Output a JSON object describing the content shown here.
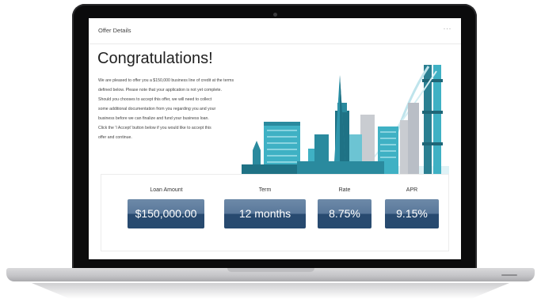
{
  "header": {
    "title": "Offer Details",
    "more": "···"
  },
  "heading": "Congratulations!",
  "message_lines": [
    "We are pleased to offer you a $150,000 business line of credit at the terms",
    "defined below.  Please note that your application is not yet complete.",
    "Should you chooses to accept this offer, we will need to collect",
    "some additional documentation from you regarding you and your",
    "business before we can finalize and fund your business loan.",
    "Click the 'I Accept' button below if you would like to accept this",
    "offer and continue."
  ],
  "metrics": {
    "loan_amount": {
      "label": "Loan Amount",
      "value": "$150,000.00"
    },
    "term": {
      "label": "Term",
      "value": "12 months"
    },
    "rate": {
      "label": "Rate",
      "value": "8.75%"
    },
    "apr": {
      "label": "APR",
      "value": "9.15%"
    }
  },
  "colors": {
    "accent_dark": "#274a6f",
    "accent_light": "#6d8aa8",
    "skyline_teal": "#3fb1c4",
    "skyline_dark": "#1f7285"
  }
}
